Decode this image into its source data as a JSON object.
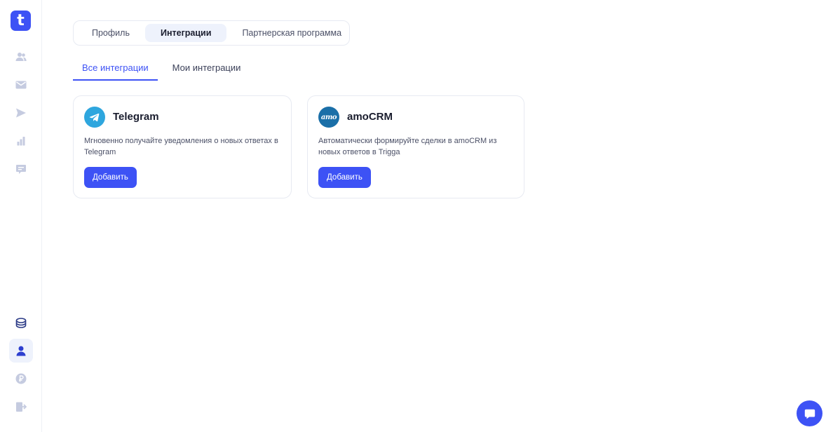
{
  "brand": {
    "logo_letter": "t",
    "accent": "#3d52f5"
  },
  "sidebar": {
    "top_items": [
      {
        "icon": "users-icon"
      },
      {
        "icon": "mail-icon"
      },
      {
        "icon": "send-icon"
      },
      {
        "icon": "bar-chart-icon"
      },
      {
        "icon": "message-icon"
      }
    ],
    "bottom_items": [
      {
        "icon": "coins-icon"
      },
      {
        "icon": "user-icon",
        "active": true
      },
      {
        "icon": "ruble-icon"
      },
      {
        "icon": "logout-icon"
      }
    ]
  },
  "tabs": {
    "profile": "Профиль",
    "integrations": "Интеграции",
    "partner": "Партнерская программа",
    "active": "integrations"
  },
  "subtabs": {
    "all": "Все интеграции",
    "mine": "Мои интеграции",
    "active": "all"
  },
  "cards": [
    {
      "title": "Telegram",
      "description": "Мгновенно получайте уведомления о новых ответах в Telegram",
      "button": "Добавить",
      "icon": "telegram-icon"
    },
    {
      "title": "amoCRM",
      "description": "Автоматически формируйте сделки в amoCRM из новых ответов в Trigga",
      "button": "Добавить",
      "icon": "amocrm-icon",
      "logo_text": "amo"
    }
  ],
  "chat": {
    "icon": "chat-icon"
  }
}
